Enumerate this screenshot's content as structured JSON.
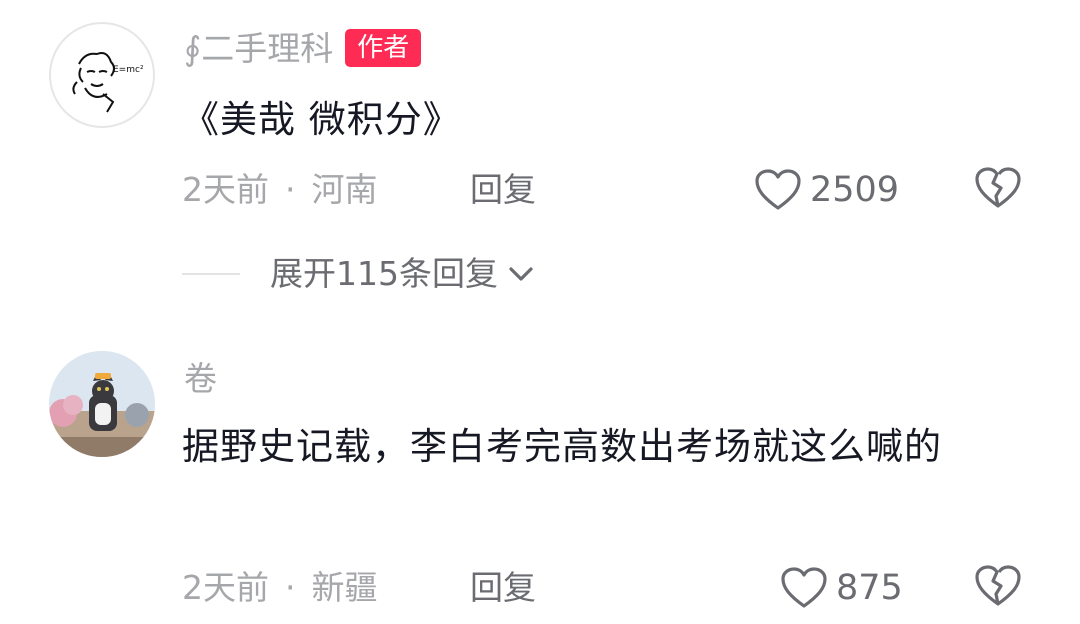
{
  "comments": [
    {
      "username": "∮二手理科",
      "badge": "作者",
      "text": "《美哉 微积分》",
      "time": "2天前",
      "sep": "·",
      "location": "河南",
      "reply_label": "回复",
      "likes": "2509",
      "expand_label": "展开115条回复"
    },
    {
      "username": "卷",
      "text": "据野史记载，李白考完高数出考场就这么喊的",
      "time": "2天前",
      "sep": "·",
      "location": "新疆",
      "reply_label": "回复",
      "likes": "875"
    }
  ]
}
